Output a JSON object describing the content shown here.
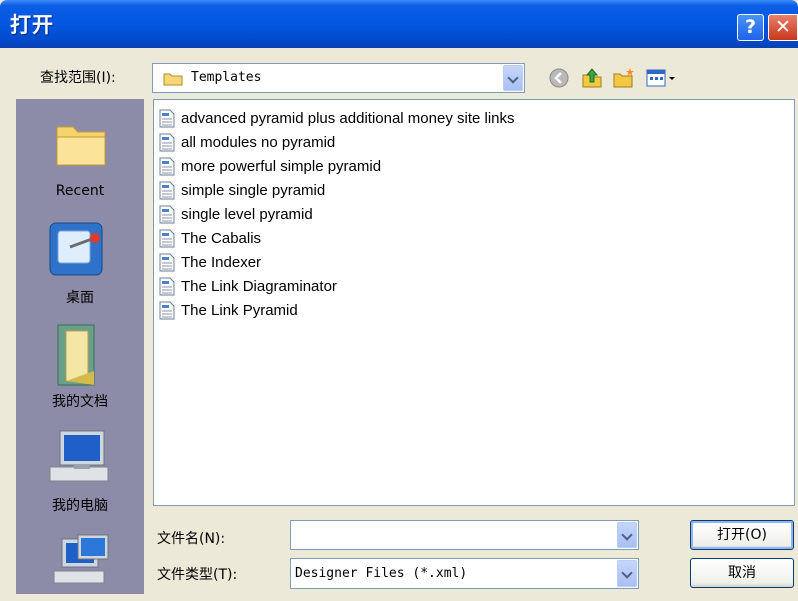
{
  "window": {
    "title": "打开"
  },
  "titlebar": {
    "help": "?",
    "close": "✕"
  },
  "lookin": {
    "label": "查找范围(I):",
    "value": "Templates"
  },
  "toolbar": {
    "icons": [
      "back-icon",
      "up-folder-icon",
      "new-folder-icon",
      "view-menu-icon"
    ]
  },
  "places": [
    {
      "label": "Recent"
    },
    {
      "label": "桌面"
    },
    {
      "label": "我的文档"
    },
    {
      "label": "我的电脑"
    },
    {
      "label": ""
    }
  ],
  "files": [
    "advanced pyramid plus additional money site links",
    "all modules no pyramid",
    "more powerful simple pyramid",
    "simple single pyramid",
    "single level pyramid",
    "The Cabalis",
    "The Indexer",
    "The Link Diagraminator",
    "The Link Pyramid"
  ],
  "filename": {
    "label": "文件名(N):",
    "value": ""
  },
  "filetype": {
    "label": "文件类型(T):",
    "value": "Designer Files (*.xml)"
  },
  "buttons": {
    "open": "打开(O)",
    "cancel": "取消"
  }
}
